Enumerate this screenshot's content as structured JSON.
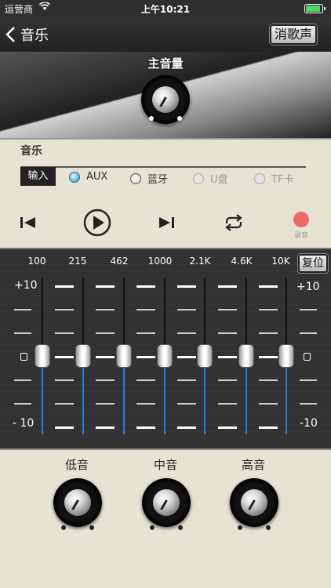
{
  "status": {
    "carrier": "运营商",
    "time": "上午10:21"
  },
  "nav": {
    "back_label": "音乐",
    "mute_label": "消歌声"
  },
  "master": {
    "label": "主音量"
  },
  "music": {
    "title": "音乐",
    "input_label": "输入",
    "inputs": [
      {
        "label": "AUX",
        "state": "selected"
      },
      {
        "label": "蓝牙",
        "state": "normal"
      },
      {
        "label": "U盘",
        "state": "disabled"
      },
      {
        "label": "TF卡",
        "state": "disabled"
      }
    ],
    "record_label": "录音"
  },
  "eq": {
    "reset_label": "复位",
    "freqs": [
      "100",
      "215",
      "462",
      "1000",
      "2.1K",
      "4.6K",
      "10K"
    ],
    "scale": {
      "top": "+10",
      "bottom": "- 10",
      "top_right": "+10",
      "bottom_right": "-10"
    },
    "values": [
      0,
      0,
      0,
      0,
      0,
      0,
      0
    ]
  },
  "tone": {
    "labels": [
      "低音",
      "中音",
      "高音"
    ]
  },
  "colors": {
    "accent": "#2a7de1",
    "radio_active": "#62bfe8",
    "record": "#f06a6a"
  }
}
